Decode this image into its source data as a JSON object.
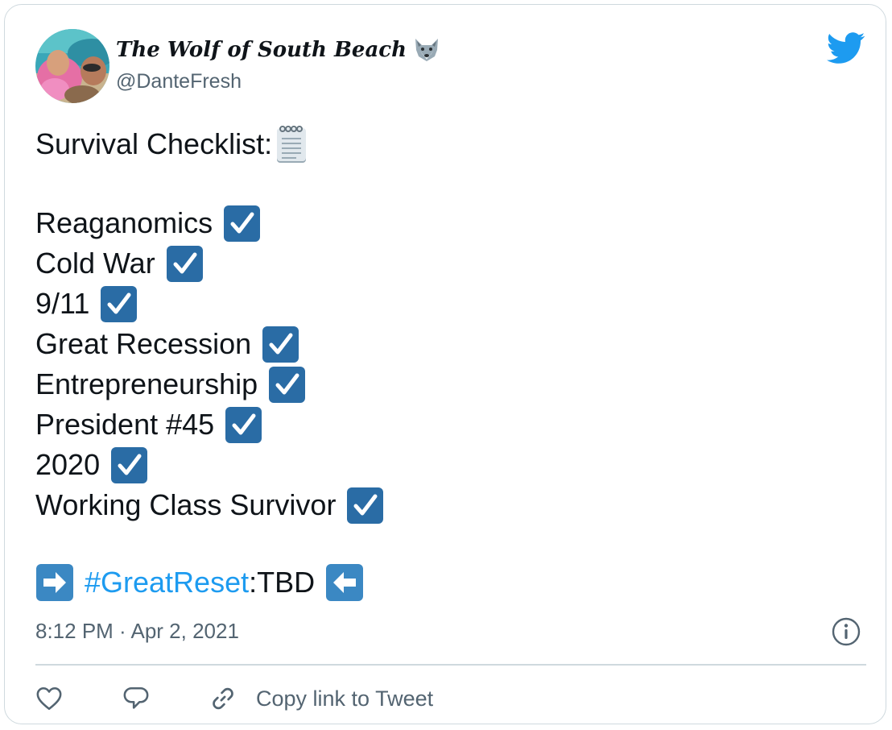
{
  "author": {
    "display_name": "The Wolf of South Beach",
    "handle": "@DanteFresh",
    "avatar_icon": "avatar-photo",
    "name_emoji_icon": "wolf-icon"
  },
  "platform_icon": "twitter-bird-icon",
  "tweet": {
    "heading": "Survival Checklist:",
    "heading_icon": "notepad-icon",
    "checklist": [
      "Reaganomics",
      "Cold War",
      "9/11",
      "Great Recession",
      "Entrepreneurship",
      "President #45",
      "2020",
      "Working Class Survivor"
    ],
    "checklist_icon": "check-box-icon",
    "hashtag": "#GreatReset",
    "hashtag_suffix": ":TBD"
  },
  "timestamp": "8:12 PM · Apr 2, 2021",
  "actions": {
    "copy_link_label": "Copy link to Tweet"
  },
  "colors": {
    "accent": "#1d9bf0",
    "check_box": "#2a6ca5",
    "arrow_box": "#3b88c3",
    "muted_text": "#536471",
    "border": "#cfd9de"
  }
}
